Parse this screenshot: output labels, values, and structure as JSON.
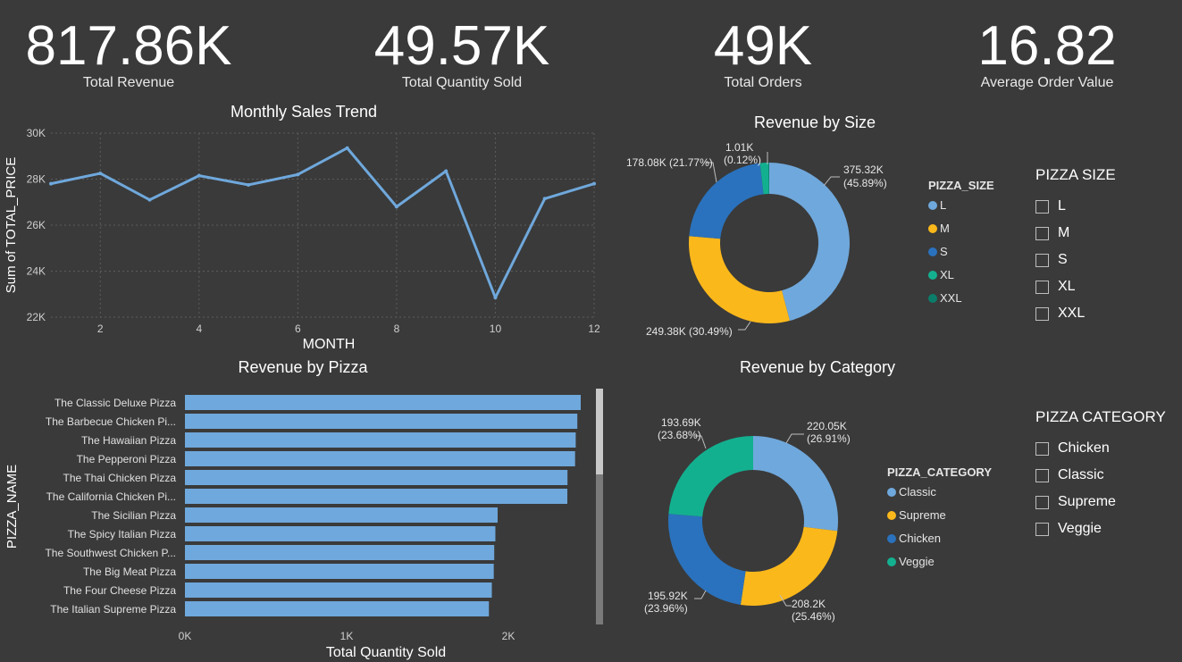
{
  "kpis": [
    {
      "value": "817.86K",
      "label": "Total Revenue"
    },
    {
      "value": "49.57K",
      "label": "Total Quantity Sold"
    },
    {
      "value": "49K",
      "label": "Total Orders"
    },
    {
      "value": "16.82",
      "label": "Average Order Value"
    }
  ],
  "colors": {
    "background": "#3a3a3a",
    "line": "#6fa8dc",
    "bar": "#6fa8dc",
    "L": "#6fa8dc",
    "M": "#fbb81b",
    "S": "#2a72bd",
    "XL": "#13b090",
    "XXL": "#0b7d6a"
  },
  "chart_data": [
    {
      "type": "line",
      "title": "Monthly Sales Trend",
      "xlabel": "MONTH",
      "ylabel": "Sum of TOTAL_PRICE",
      "x": [
        1,
        2,
        3,
        4,
        5,
        6,
        7,
        8,
        9,
        10,
        11,
        12
      ],
      "values": [
        27800,
        28250,
        27100,
        28150,
        27750,
        28200,
        29350,
        26800,
        28350,
        22850,
        27150,
        27800
      ],
      "ylim": [
        22000,
        30000
      ],
      "yticks": [
        "22K",
        "24K",
        "26K",
        "28K",
        "30K"
      ],
      "xticks": [
        "2",
        "4",
        "6",
        "8",
        "10",
        "12"
      ],
      "grid": true
    },
    {
      "type": "pie",
      "title": "Revenue by Size",
      "legend_title": "PIZZA_SIZE",
      "slices": [
        {
          "name": "L",
          "value": 375.32,
          "label": "375.32K",
          "pct": "(45.89%)",
          "color": "#6fa8dc"
        },
        {
          "name": "M",
          "value": 249.38,
          "label": "249.38K (30.49%)",
          "pct": "",
          "color": "#fbb81b"
        },
        {
          "name": "S",
          "value": 178.08,
          "label": "178.08K (21.77%)",
          "pct": "",
          "color": "#2a72bd"
        },
        {
          "name": "XL",
          "value": 14.1,
          "label": "",
          "pct": "",
          "color": "#13b090"
        },
        {
          "name": "XXL",
          "value": 1.01,
          "label": "1.01K",
          "pct": "(0.12%)",
          "color": "#0b7d6a"
        }
      ]
    },
    {
      "type": "bar",
      "title": "Revenue by Pizza",
      "xlabel": "Total Quantity Sold",
      "ylabel": "PIZZA_NAME",
      "categories": [
        "The Classic Deluxe Pizza",
        "The Barbecue Chicken Pi...",
        "The Hawaiian Pizza",
        "The Pepperoni Pizza",
        "The Thai Chicken Pizza",
        "The California Chicken Pi...",
        "The Sicilian Pizza",
        "The Spicy Italian Pizza",
        "The Southwest Chicken P...",
        "The Big Meat Pizza",
        "The Four Cheese Pizza",
        "The Italian Supreme Pizza"
      ],
      "values": [
        2453,
        2432,
        2422,
        2418,
        2371,
        2370,
        1938,
        1924,
        1917,
        1914,
        1902,
        1884
      ],
      "xlim": [
        0,
        2500
      ],
      "xticks": [
        "0K",
        "1K",
        "2K"
      ]
    },
    {
      "type": "pie",
      "title": "Revenue by Category",
      "legend_title": "PIZZA_CATEGORY",
      "slices": [
        {
          "name": "Classic",
          "value": 220.05,
          "label": "220.05K",
          "pct": "(26.91%)",
          "color": "#6fa8dc"
        },
        {
          "name": "Supreme",
          "value": 208.2,
          "label": "208.2K",
          "pct": "(25.46%)",
          "color": "#fbb81b"
        },
        {
          "name": "Chicken",
          "value": 195.92,
          "label": "195.92K",
          "pct": "(23.96%)",
          "color": "#2a72bd"
        },
        {
          "name": "Veggie",
          "value": 193.69,
          "label": "193.69K",
          "pct": "(23.68%)",
          "color": "#13b090"
        }
      ]
    }
  ],
  "slicers": {
    "size": {
      "title": "PIZZA SIZE",
      "items": [
        "L",
        "M",
        "S",
        "XL",
        "XXL"
      ]
    },
    "category": {
      "title": "PIZZA CATEGORY",
      "items": [
        "Chicken",
        "Classic",
        "Supreme",
        "Veggie"
      ]
    }
  }
}
